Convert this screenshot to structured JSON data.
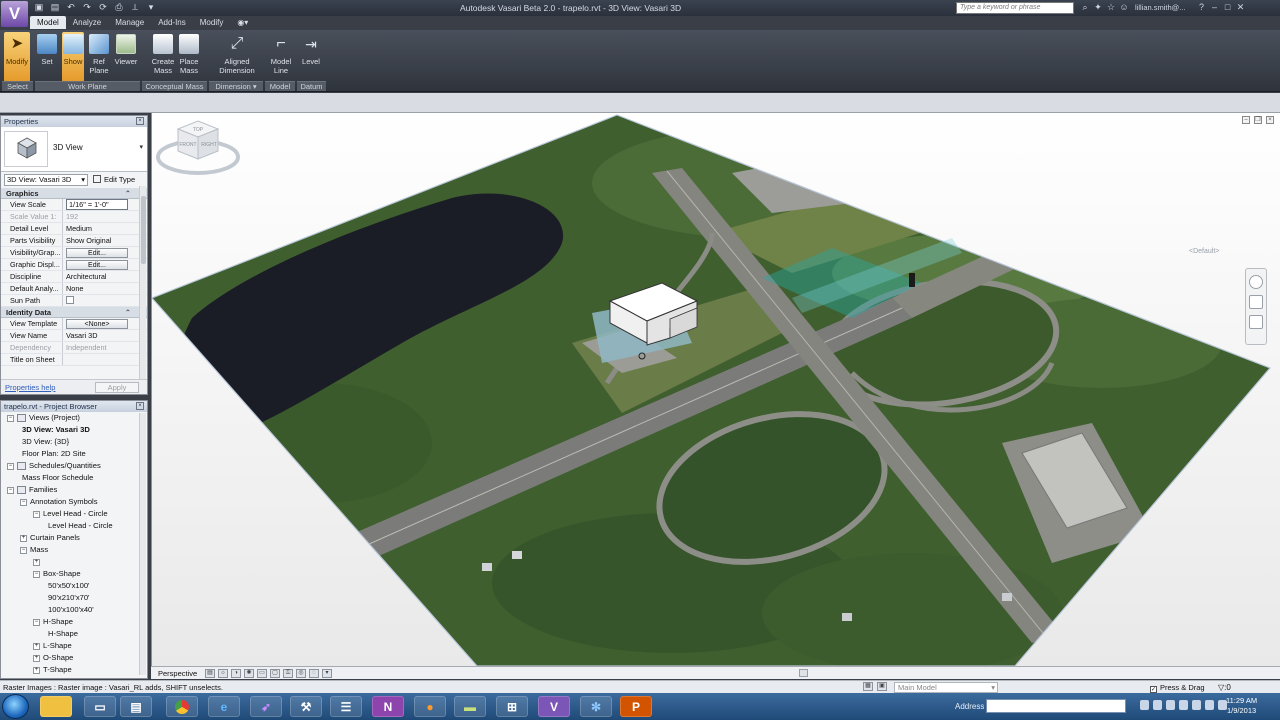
{
  "app": {
    "title": "Autodesk Vasari Beta 2.0 -   trapelo.rvt - 3D View: Vasari 3D",
    "app_button": "V",
    "search_placeholder": "Type a keyword or phrase",
    "user": "lillian.smith@...",
    "accent_color": "#7b56b6"
  },
  "ribbon": {
    "tabs": [
      "Model",
      "Analyze",
      "Manage",
      "Add-Ins",
      "Modify"
    ],
    "active_tab": "Model",
    "buttons": {
      "modify": "Modify",
      "set": "Set",
      "show": "Show",
      "ref_plane_1": "Ref",
      "ref_plane_2": "Plane",
      "viewer": "Viewer",
      "create_mass_1": "Create",
      "create_mass_2": "Mass",
      "place_mass_1": "Place",
      "place_mass_2": "Mass",
      "aligned_dim_1": "Aligned",
      "aligned_dim_2": "Dimension",
      "model_line_1": "Model",
      "model_line_2": "Line",
      "level": "Level"
    },
    "panels": {
      "select": "Select",
      "work_plane": "Work Plane",
      "conceptual_mass": "Conceptual Mass",
      "dimension": "Dimension ▾",
      "model": "Model",
      "datum": "Datum"
    }
  },
  "properties": {
    "header": "Properties",
    "type_name": "3D View",
    "instance_selector": "3D View: Vasari 3D",
    "edit_type": "Edit Type",
    "groups": {
      "graphics": "Graphics",
      "identity": "Identity Data"
    },
    "rows": {
      "view_scale_k": "View Scale",
      "view_scale_v": "1/16\" = 1'-0\"",
      "scale_value_k": "Scale Value   1:",
      "scale_value_v": "192",
      "detail_level_k": "Detail Level",
      "detail_level_v": "Medium",
      "parts_vis_k": "Parts Visibility",
      "parts_vis_v": "Show Original",
      "vis_graph_k": "Visibility/Grap...",
      "vis_graph_v": "Edit...",
      "graphic_disp_k": "Graphic Displ...",
      "graphic_disp_v": "Edit...",
      "discipline_k": "Discipline",
      "discipline_v": "Architectural",
      "default_anal_k": "Default Analy...",
      "default_anal_v": "None",
      "sun_path_k": "Sun Path",
      "view_template_k": "View Template",
      "view_template_v": "<None>",
      "view_name_k": "View Name",
      "view_name_v": "Vasari 3D",
      "dependency_k": "Dependency",
      "dependency_v": "Independent",
      "title_on_sheet_k": "Title on Sheet",
      "title_on_sheet_v": ""
    },
    "help_link": "Properties help",
    "apply": "Apply"
  },
  "project_browser": {
    "header": "trapelo.rvt - Project Browser",
    "items": [
      {
        "label": "Views (Project)",
        "level": 0,
        "toggle": "−"
      },
      {
        "label": "3D View: Vasari 3D",
        "level": 1,
        "toggle": ""
      },
      {
        "label": "3D View: {3D}",
        "level": 1,
        "toggle": ""
      },
      {
        "label": "Floor Plan: 2D Site",
        "level": 1,
        "toggle": ""
      },
      {
        "label": "Schedules/Quantities",
        "level": 0,
        "toggle": "−"
      },
      {
        "label": "Mass Floor Schedule",
        "level": 1,
        "toggle": ""
      },
      {
        "label": "Families",
        "level": 0,
        "toggle": "−"
      },
      {
        "label": "Annotation Symbols",
        "level": 1,
        "toggle": "−"
      },
      {
        "label": "Level Head - Circle",
        "level": 2,
        "toggle": "−"
      },
      {
        "label": "Level Head - Circle",
        "level": 3,
        "toggle": ""
      },
      {
        "label": "Curtain Panels",
        "level": 1,
        "toggle": "+"
      },
      {
        "label": "Mass",
        "level": 1,
        "toggle": "−"
      },
      {
        "label": "",
        "level": 2,
        "toggle": "+"
      },
      {
        "label": "Box-Shape",
        "level": 2,
        "toggle": "−"
      },
      {
        "label": "50'x50'x100'",
        "level": 3,
        "toggle": ""
      },
      {
        "label": "90'x210'x70'",
        "level": 3,
        "toggle": ""
      },
      {
        "label": "100'x100'x40'",
        "level": 3,
        "toggle": ""
      },
      {
        "label": "H-Shape",
        "level": 2,
        "toggle": "−"
      },
      {
        "label": "H-Shape",
        "level": 3,
        "toggle": ""
      },
      {
        "label": "L-Shape",
        "level": 2,
        "toggle": "+"
      },
      {
        "label": "O-Shape",
        "level": 2,
        "toggle": "+"
      },
      {
        "label": "T-Shape",
        "level": 2,
        "toggle": "+"
      }
    ]
  },
  "viewport": {
    "viewcube_default": "<Default>",
    "viewcube_faces": [
      "TOP",
      "FRONT",
      "RIGHT"
    ]
  },
  "view_control": {
    "mode": "Perspective"
  },
  "status": {
    "text": "Raster Images : Raster image : Vasari_RL adds, SHIFT unselects.",
    "model": "Main Model",
    "press_drag": "Press & Drag"
  },
  "taskbar": {
    "address_label": "Address",
    "time": "11:29 AM",
    "date": "1/9/2013",
    "apps": [
      "folder",
      "explorer",
      "chrome",
      "ie",
      "vasari",
      "tools",
      "notes",
      "N",
      "firefox",
      "files",
      "network",
      "V",
      "settings",
      "P"
    ]
  }
}
